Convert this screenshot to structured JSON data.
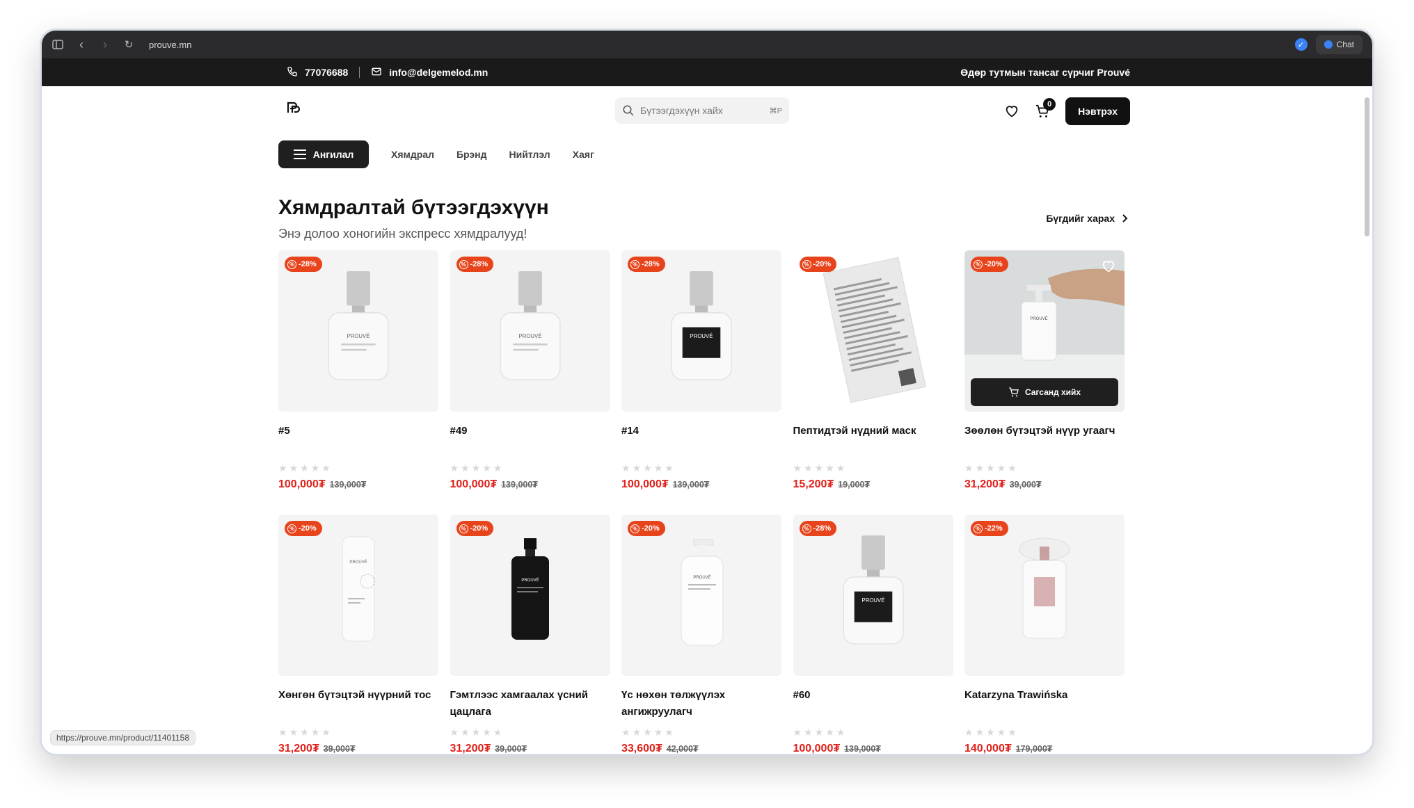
{
  "browser": {
    "url": "prouve.mn",
    "chat_label": "Chat",
    "status_url": "https://prouve.mn/product/11401158"
  },
  "topbar": {
    "phone": "77076688",
    "email": "info@delgemelod.mn",
    "tagline": "Өдөр тутмын тансаг сүрчиг Prouvé"
  },
  "header": {
    "search_placeholder": "Бүтээгдэхүүн хайх",
    "search_shortcut": "⌘P",
    "cart_count": "0",
    "login_label": "Нэвтрэх"
  },
  "nav": {
    "category_label": "Ангилал",
    "links": [
      "Хямдрал",
      "Брэнд",
      "Нийтлэл",
      "Хаяг"
    ]
  },
  "section": {
    "title": "Хямдралтай бүтээгдэхүүн",
    "subtitle": "Энэ долоо хоногийн экспресс хямдралууд!",
    "see_all": "Бүгдийг харах"
  },
  "add_to_cart_label": "Сагсанд хийх",
  "products": [
    {
      "name": "#5",
      "discount": "-28%",
      "price": "100,000₮",
      "old_price": "139,000₮",
      "art": "perfume-white",
      "rating": 0
    },
    {
      "name": "#49",
      "discount": "-28%",
      "price": "100,000₮",
      "old_price": "139,000₮",
      "art": "perfume-white",
      "rating": 0
    },
    {
      "name": "#14",
      "discount": "-28%",
      "price": "100,000₮",
      "old_price": "139,000₮",
      "art": "perfume-black",
      "rating": 0
    },
    {
      "name": "Пептидтэй нүдний маск",
      "discount": "-20%",
      "price": "15,200₮",
      "old_price": "19,000₮",
      "art": "mask-sachet",
      "rating": 0
    },
    {
      "name": "Зөөлөн бүтэцтэй нүүр угаагч",
      "discount": "-20%",
      "price": "31,200₮",
      "old_price": "39,000₮",
      "art": "pump-hand",
      "rating": 0,
      "hovered": true
    },
    {
      "name": "Хөнгөн бүтэцтэй нүүрний тос",
      "discount": "-20%",
      "price": "31,200₮",
      "old_price": "39,000₮",
      "art": "airless-bottle",
      "rating": 0
    },
    {
      "name": "Гэмтлээс хамгаалах үсний цацлага",
      "discount": "-20%",
      "price": "31,200₮",
      "old_price": "39,000₮",
      "art": "spray-black",
      "rating": 0
    },
    {
      "name": "Үс нөхөн төлжүүлэх ангижруулагч",
      "discount": "-20%",
      "price": "33,600₮",
      "old_price": "42,000₮",
      "art": "pump-white",
      "rating": 0
    },
    {
      "name": "#60",
      "discount": "-28%",
      "price": "100,000₮",
      "old_price": "139,000₮",
      "art": "perfume-black",
      "rating": 0
    },
    {
      "name": "Katarzyna Trawińska",
      "discount": "-22%",
      "price": "140,000₮",
      "old_price": "179,000₮",
      "art": "perfume-pink",
      "rating": 0
    }
  ]
}
